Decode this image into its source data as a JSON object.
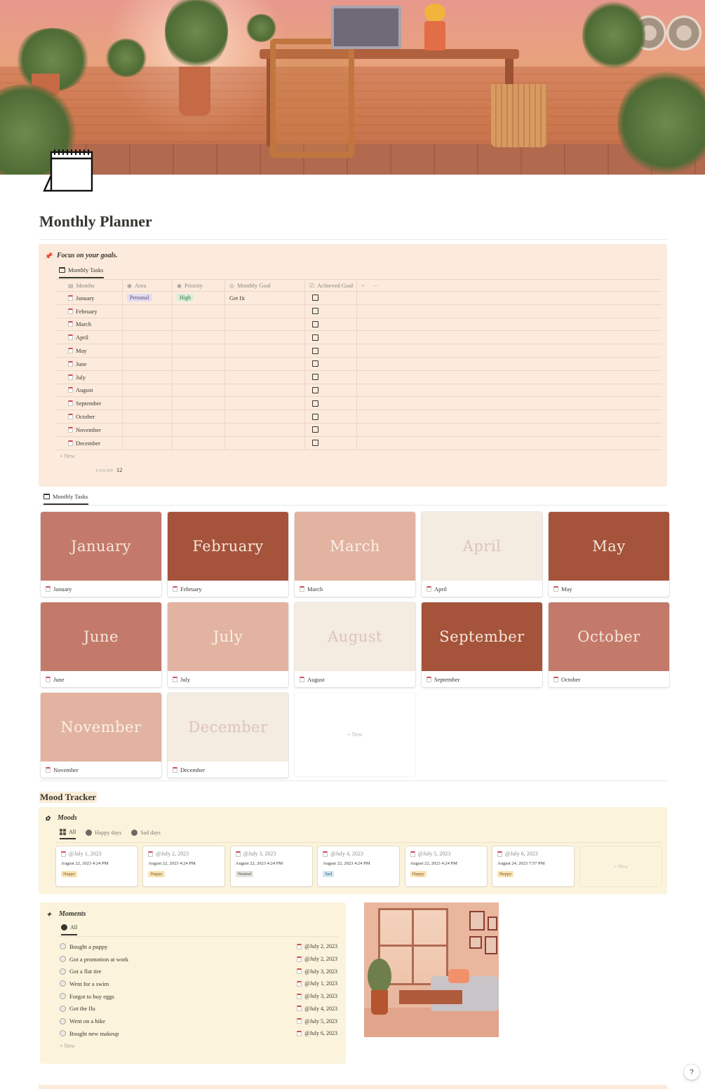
{
  "page": {
    "title": "Monthly Planner"
  },
  "goals": {
    "callout_title": "Focus on your goals.",
    "view_tab": "Monthly Tasks",
    "columns": [
      "Months",
      "Area",
      "Priority",
      "Monthly Goal",
      "Achieved Goal"
    ],
    "rows": [
      {
        "month": "January",
        "area": "Personal",
        "priority": "High",
        "goal": "Get fit"
      },
      {
        "month": "February",
        "area": "",
        "priority": "",
        "goal": ""
      },
      {
        "month": "March",
        "area": "",
        "priority": "",
        "goal": ""
      },
      {
        "month": "April",
        "area": "",
        "priority": "",
        "goal": ""
      },
      {
        "month": "May",
        "area": "",
        "priority": "",
        "goal": ""
      },
      {
        "month": "June",
        "area": "",
        "priority": "",
        "goal": ""
      },
      {
        "month": "July",
        "area": "",
        "priority": "",
        "goal": ""
      },
      {
        "month": "August",
        "area": "",
        "priority": "",
        "goal": ""
      },
      {
        "month": "September",
        "area": "",
        "priority": "",
        "goal": ""
      },
      {
        "month": "October",
        "area": "",
        "priority": "",
        "goal": ""
      },
      {
        "month": "November",
        "area": "",
        "priority": "",
        "goal": ""
      },
      {
        "month": "December",
        "area": "",
        "priority": "",
        "goal": ""
      }
    ],
    "new_label": "New",
    "count_label": "COUNT",
    "count_value": "12"
  },
  "gallery": {
    "view_tab": "Monthly Tasks",
    "cards": [
      {
        "cover_text": "January",
        "label": "January",
        "bg": "#c47a6a",
        "fg": "#f6e6dd"
      },
      {
        "cover_text": "February",
        "label": "February",
        "bg": "#a5533a",
        "fg": "#f6e6dd"
      },
      {
        "cover_text": "March",
        "label": "March",
        "bg": "#e2b3a0",
        "fg": "#faf0ea"
      },
      {
        "cover_text": "April",
        "label": "April",
        "bg": "#f4ebe1",
        "fg": "#dcc4b7"
      },
      {
        "cover_text": "May",
        "label": "May",
        "bg": "#a5533a",
        "fg": "#f6e6dd"
      },
      {
        "cover_text": "June",
        "label": "June",
        "bg": "#c47a6a",
        "fg": "#f6e6dd"
      },
      {
        "cover_text": "July",
        "label": "July",
        "bg": "#e2b3a0",
        "fg": "#faf0ea"
      },
      {
        "cover_text": "August",
        "label": "August",
        "bg": "#f4ebe1",
        "fg": "#dcc4b7"
      },
      {
        "cover_text": "September",
        "label": "September",
        "bg": "#a5533a",
        "fg": "#f6e6dd"
      },
      {
        "cover_text": "October",
        "label": "October",
        "bg": "#c47a6a",
        "fg": "#f6e6dd"
      },
      {
        "cover_text": "November",
        "label": "November",
        "bg": "#e2b3a0",
        "fg": "#faf0ea"
      },
      {
        "cover_text": "December",
        "label": "December",
        "bg": "#f4ebe1",
        "fg": "#dcc4b7"
      }
    ],
    "new_label": "+ New"
  },
  "mood_tracker": {
    "heading": "Mood Tracker",
    "callout_title": "Moods",
    "tabs": [
      "All",
      "Happy days",
      "Sad days"
    ],
    "entries": [
      {
        "date": "@July 1, 2023",
        "timestamp": "August 22, 2023 4:24 PM",
        "mood": "Happy",
        "tag_bg": "#fbe4b6",
        "tag_fg": "#7a5420"
      },
      {
        "date": "@July 2, 2023",
        "timestamp": "August 22, 2023 4:24 PM",
        "mood": "Happy",
        "tag_bg": "#fbe4b6",
        "tag_fg": "#7a5420"
      },
      {
        "date": "@July 3, 2023",
        "timestamp": "August 22, 2023 4:24 PM",
        "mood": "Neutral",
        "tag_bg": "#e6e4df",
        "tag_fg": "#4d4a45"
      },
      {
        "date": "@July 4, 2023",
        "timestamp": "August 22, 2023 4:24 PM",
        "mood": "Sad",
        "tag_bg": "#d3e5ef",
        "tag_fg": "#2b5c7a"
      },
      {
        "date": "@July 5, 2023",
        "timestamp": "August 22, 2023 4:24 PM",
        "mood": "Happy",
        "tag_bg": "#fbe4b6",
        "tag_fg": "#7a5420"
      },
      {
        "date": "@July 6, 2023",
        "timestamp": "August 24, 2023 7:57 PM",
        "mood": "Happy",
        "tag_bg": "#fbe4b6",
        "tag_fg": "#7a5420"
      }
    ],
    "new_label": "+ New"
  },
  "moments": {
    "callout_title": "Moments",
    "tab": "All",
    "items": [
      {
        "title": "Bought a puppy",
        "date": "@July 2, 2023"
      },
      {
        "title": "Got a promotion at work",
        "date": "@July 2, 2023"
      },
      {
        "title": "Got a flat tire",
        "date": "@July 3, 2023"
      },
      {
        "title": "Went for a swim",
        "date": "@July 1, 2023"
      },
      {
        "title": "Forgot to buy eggs",
        "date": "@July 3, 2023"
      },
      {
        "title": "Got the flu",
        "date": "@July 4, 2023"
      },
      {
        "title": "Went on a hike",
        "date": "@July 5, 2023"
      },
      {
        "title": "Bought new makeup",
        "date": "@July 6, 2023"
      }
    ],
    "new_label": "New"
  },
  "help_label": "?"
}
